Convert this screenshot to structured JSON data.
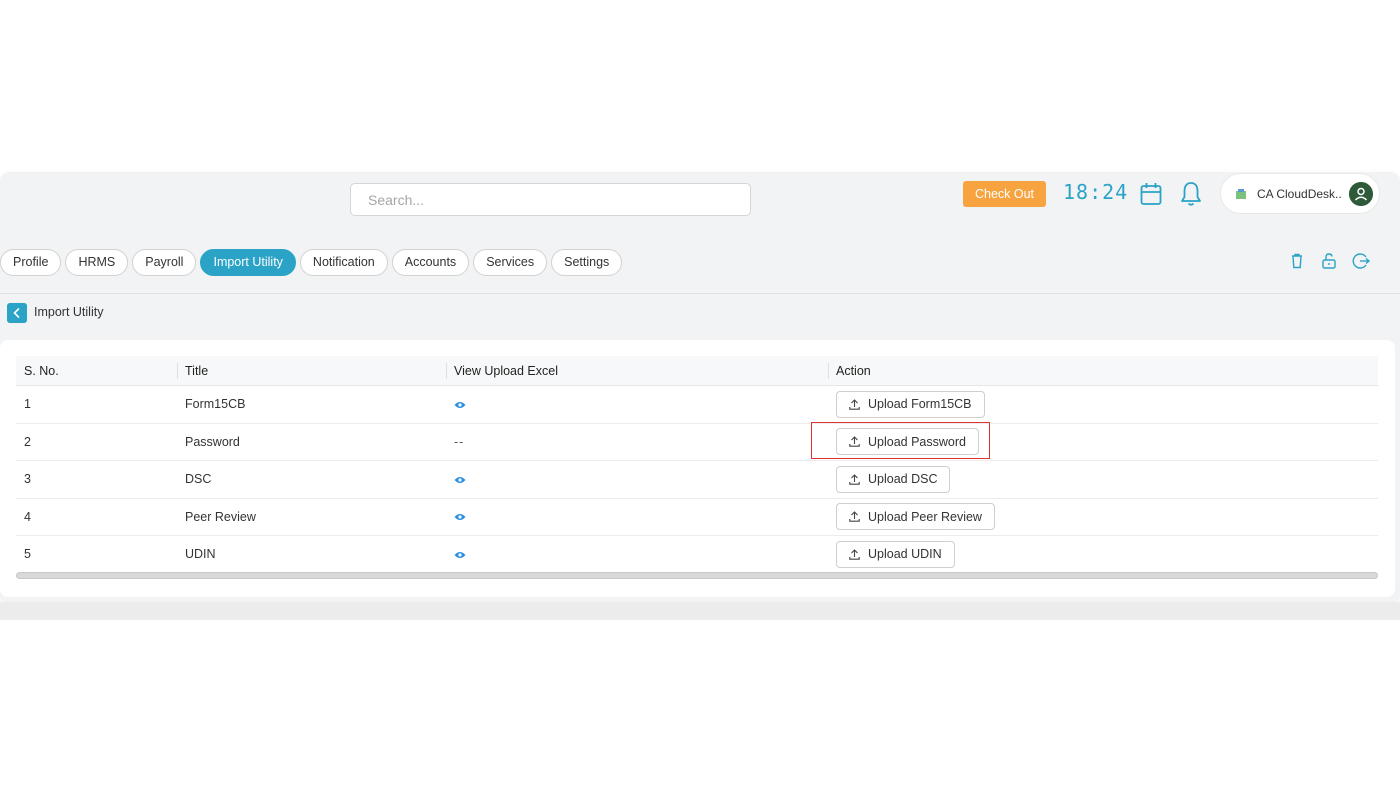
{
  "header": {
    "search_placeholder": "Search...",
    "checkout_label": "Check Out",
    "clock": "18:24",
    "org_name": "CA CloudDesk.."
  },
  "nav": {
    "tabs": [
      "Profile",
      "HRMS",
      "Payroll",
      "Import Utility",
      "Notification",
      "Accounts",
      "Services",
      "Settings"
    ],
    "active_tab": "Import Utility"
  },
  "breadcrumb": {
    "title": "Import Utility"
  },
  "table": {
    "columns": [
      "S. No.",
      "Title",
      "View Upload Excel",
      "Action"
    ],
    "rows": [
      {
        "sno": "1",
        "title": "Form15CB",
        "view": "eye",
        "action": "Upload Form15CB"
      },
      {
        "sno": "2",
        "title": "Password",
        "view": "--",
        "action": "Upload Password"
      },
      {
        "sno": "3",
        "title": "DSC",
        "view": "eye",
        "action": "Upload DSC"
      },
      {
        "sno": "4",
        "title": "Peer Review",
        "view": "eye",
        "action": "Upload Peer Review"
      },
      {
        "sno": "5",
        "title": "UDIN",
        "view": "eye",
        "action": "Upload UDIN"
      }
    ]
  },
  "colors": {
    "accent": "#2aa3c6",
    "checkout": "#f7a440",
    "highlight": "#e0322f"
  }
}
